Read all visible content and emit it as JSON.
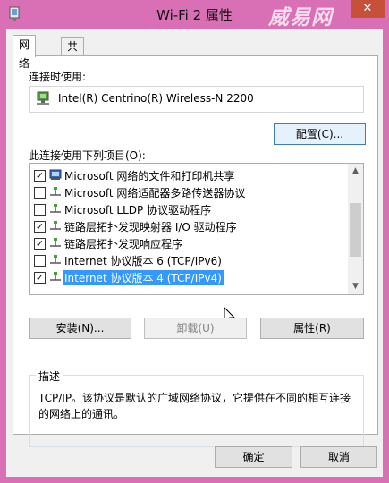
{
  "window": {
    "title": "Wi-Fi 2 属性",
    "watermark": "威易网",
    "close_icon": "close-icon",
    "accent": "#d96fb5"
  },
  "tabs": [
    {
      "label": "网络",
      "active": true
    },
    {
      "label": "共享",
      "active": false
    }
  ],
  "connect_using_label": "连接时使用:",
  "adapter": {
    "name": "Intel(R) Centrino(R) Wireless-N 2200",
    "icon": "network-adapter-icon"
  },
  "configure_button": "配置(C)...",
  "items_label": "此连接使用下列项目(O):",
  "items": [
    {
      "label": "Microsoft 网络的文件和打印机共享",
      "checked": true,
      "icon": "printer-share-icon",
      "selected": false
    },
    {
      "label": "Microsoft 网络适配器多路传送器协议",
      "checked": false,
      "icon": "protocol-icon",
      "selected": false
    },
    {
      "label": "Microsoft LLDP 协议驱动程序",
      "checked": false,
      "icon": "protocol-icon",
      "selected": false
    },
    {
      "label": "链路层拓扑发现映射器 I/O 驱动程序",
      "checked": true,
      "icon": "protocol-icon",
      "selected": false
    },
    {
      "label": "链路层拓扑发现响应程序",
      "checked": true,
      "icon": "protocol-icon",
      "selected": false
    },
    {
      "label": "Internet 协议版本 6 (TCP/IPv6)",
      "checked": false,
      "icon": "protocol-icon",
      "selected": false
    },
    {
      "label": "Internet 协议版本 4 (TCP/IPv4)",
      "checked": true,
      "icon": "protocol-icon",
      "selected": true
    }
  ],
  "buttons": {
    "install": "安装(N)...",
    "uninstall": "卸载(U)",
    "properties": "属性(R)"
  },
  "description": {
    "title": "描述",
    "text": "TCP/IP。该协议是默认的广域网络协议，它提供在不同的相互连接的网络上的通讯。"
  },
  "footer": {
    "ok": "确定",
    "cancel": "取消"
  },
  "selection_color": "#3399ff"
}
